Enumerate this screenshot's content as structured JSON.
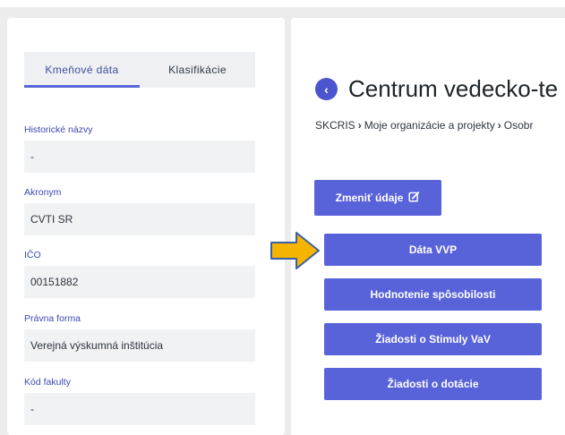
{
  "tabs": [
    "Kmeňové dáta",
    "Klasifikácie"
  ],
  "fields": [
    {
      "label": "Historické názvy",
      "value": "-"
    },
    {
      "label": "Akronym",
      "value": "CVTI SR"
    },
    {
      "label": "IČO",
      "value": "00151882"
    },
    {
      "label": "Právna forma",
      "value": "Verejná výskumná inštitúcia"
    },
    {
      "label": "Kód fakulty",
      "value": "-"
    }
  ],
  "header": {
    "back_icon": "chevron-left-icon",
    "title": "Centrum vedecko-te"
  },
  "breadcrumb": [
    "SKCRIS",
    "Moje organizácie a projekty",
    "Osobr"
  ],
  "edit_button": {
    "label": "Zmeniť údaje",
    "icon": "edit-icon"
  },
  "action_buttons": [
    "Dáta VVP",
    "Hodnotenie spôsobilosti",
    "Žiadosti o Stimuly VaV",
    "Žiadosti o dotácie"
  ],
  "annotation": {
    "icon": "arrow-right-icon",
    "color": "#f5b400"
  },
  "colors": {
    "accent": "#5963d9",
    "label": "#3d49b0",
    "field_bg": "#f1f2f4"
  }
}
